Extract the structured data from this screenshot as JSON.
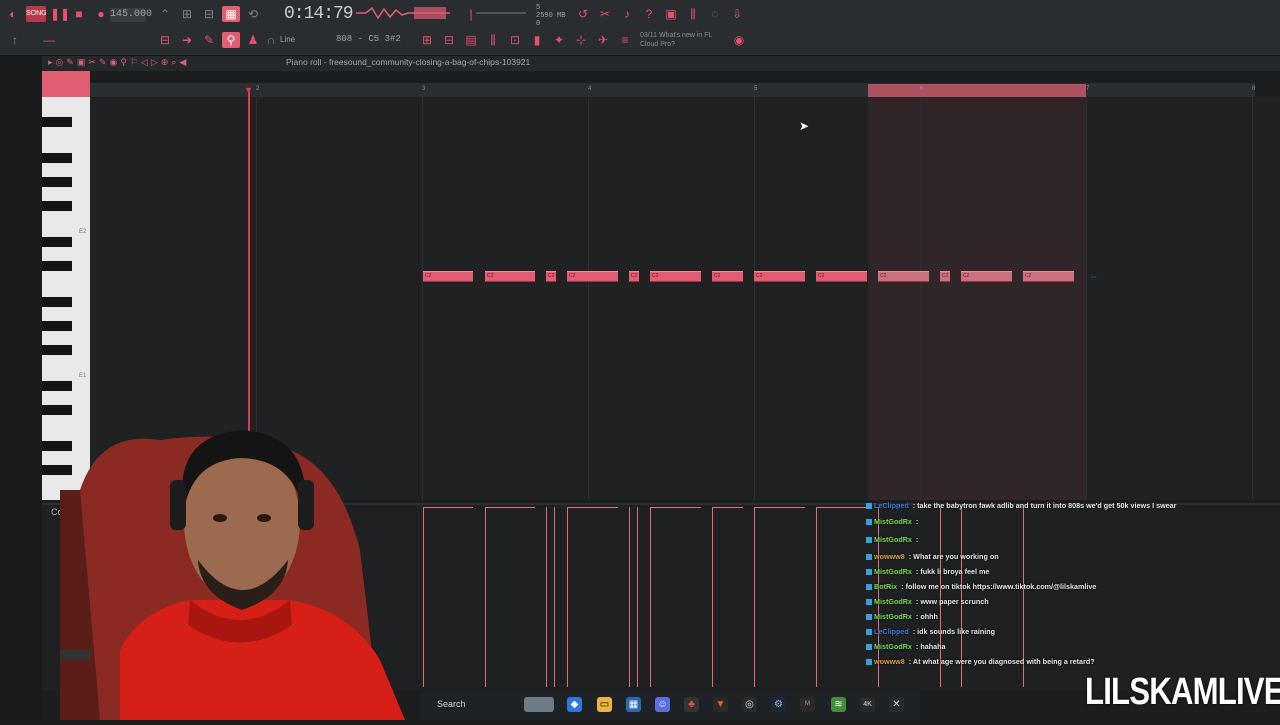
{
  "toolbar": {
    "tempo": "145.000",
    "time": "0:14:79",
    "cpu_ram": "5\n2590 MB\n0",
    "snap": "808 - C5 3#2",
    "line_mode": "Line",
    "news": "03/11  What's new in FL Cloud Pro?"
  },
  "piano_roll": {
    "title": "Piano roll - freesound_community-closing-a-bag-of-chips-103921",
    "ruler": [
      "2",
      "3",
      "4",
      "5",
      "6",
      "7",
      "8"
    ],
    "key_labels": [
      "E2",
      "E1"
    ],
    "note_label": "C2",
    "control_label": "Control"
  },
  "notes": [
    {
      "id": 1,
      "label": "C2"
    },
    {
      "id": 2,
      "label": "C2"
    },
    {
      "id": 3,
      "label": "C2"
    },
    {
      "id": 4,
      "label": "C2"
    },
    {
      "id": 5,
      "label": "C2"
    },
    {
      "id": 6,
      "label": "C2"
    },
    {
      "id": 7,
      "label": "C2"
    },
    {
      "id": 8,
      "label": "C2"
    },
    {
      "id": 9,
      "label": "C2"
    },
    {
      "id": 10,
      "label": "C2"
    },
    {
      "id": 11,
      "label": "C2"
    },
    {
      "id": 12,
      "label": "C2"
    },
    {
      "id": 13,
      "label": "C2"
    }
  ],
  "chat": [
    {
      "user": "LeClipped",
      "msg": "take the babytron fawk adlib and turn it into 808s we'd get 50k views I swear",
      "color": "#3d7bd9"
    },
    {
      "user": "MistGodRx",
      "msg": "",
      "color": "#7ed957"
    },
    {
      "user": "MistGodRx",
      "msg": "",
      "color": "#7ed957"
    },
    {
      "user": "wowww8",
      "msg": "What are you working on",
      "color": "#d9a23d"
    },
    {
      "user": "MistGodRx",
      "msg": "fukk li broya feel me",
      "color": "#7ed957"
    },
    {
      "user": "BotRix",
      "msg": "follow me on tiktok https://www.tiktok.com/@lilskamlive",
      "color": "#7ed957"
    },
    {
      "user": "MistGodRx",
      "msg": "www paper scrunch",
      "color": "#7ed957"
    },
    {
      "user": "MistGodRx",
      "msg": "ohhh",
      "color": "#7ed957"
    },
    {
      "user": "LeClipped",
      "msg": "idk sounds like raining",
      "color": "#3d7bd9"
    },
    {
      "user": "MistGodRx",
      "msg": "hahaha",
      "color": "#7ed957"
    },
    {
      "user": "wowww8",
      "msg": "At what age were you diagnosed with being a retard?",
      "color": "#d9a23d"
    }
  ],
  "taskbar": {
    "search": "Search"
  },
  "brand": "LILSKAMLIVE",
  "colors": {
    "accent": "#e05d72",
    "playhead": "#e2394f"
  }
}
